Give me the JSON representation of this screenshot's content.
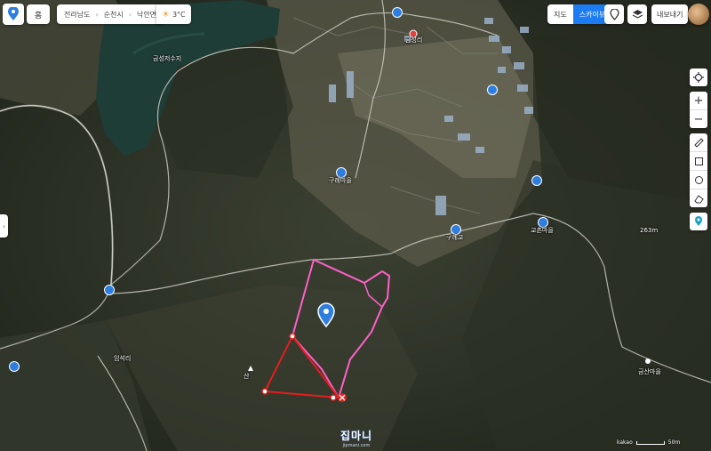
{
  "toolbar": {
    "home_label": "홈",
    "breadcrumb": [
      "전라남도",
      "순천시",
      "낙안면"
    ],
    "weather": "3°C",
    "map_label": "지도",
    "skyview_label": "스카이뷰",
    "share_label": "내보내기"
  },
  "map": {
    "labels": {
      "reservoir": "금성저수지",
      "village_poi": "금성리",
      "poi_center_a": "구례마을",
      "poi_center_b": "구례교",
      "poi_right": "교촌마을",
      "mountain": "산",
      "left_village": "임석리",
      "bottom_right": "금산마을",
      "peak": "263m"
    },
    "colors": {
      "parcel_outline": "#ff5fc8",
      "measure_line": "#e21f1f",
      "pin": "#2e7ee0"
    }
  },
  "watermark": {
    "title": "집마니",
    "url": "jipmani.com"
  },
  "scale": {
    "brand": "kakao",
    "distance": "50m"
  }
}
